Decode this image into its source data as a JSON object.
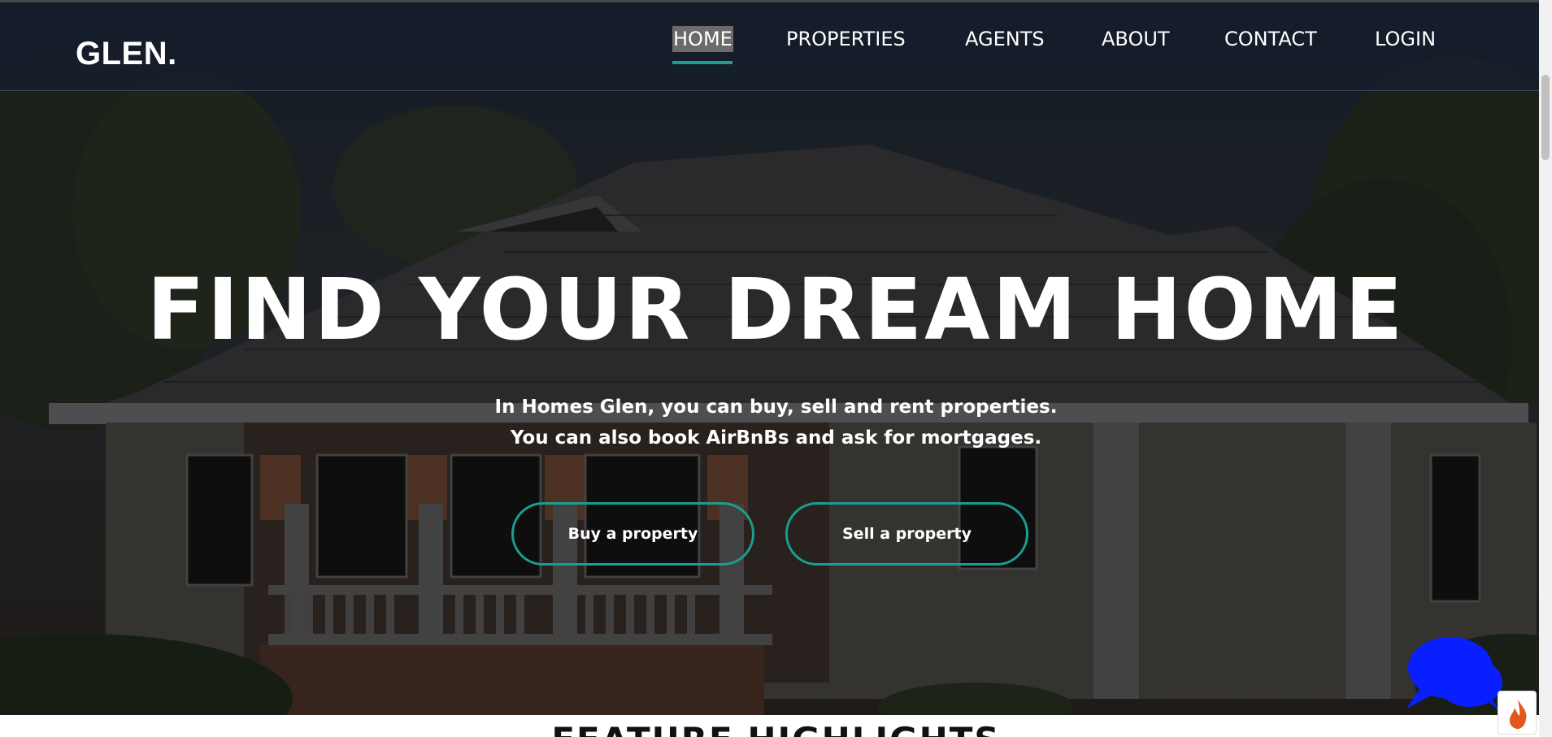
{
  "brand": "GLEN.",
  "nav": {
    "items": [
      {
        "label": "HOME",
        "active": true
      },
      {
        "label": "PROPERTIES"
      },
      {
        "label": "AGENTS"
      },
      {
        "label": "ABOUT"
      },
      {
        "label": "CONTACT"
      },
      {
        "label": "LOGIN"
      }
    ]
  },
  "hero": {
    "title": "FIND YOUR DREAM HOME",
    "subtitle_line1": "In Homes Glen, you can buy, sell and rent properties.",
    "subtitle_line2": "You can also book AirBnBs and ask for mortgages.",
    "buy_button": "Buy a property",
    "sell_button": "Sell a property"
  },
  "next_section": {
    "heading": "FEATURE HIGHLIGHTS"
  },
  "colors": {
    "accent": "#1a9e93",
    "navbar_bg": "#161e2c",
    "chat_bubble": "#0a1fff",
    "fire_icon": "#e2571e"
  },
  "icons": {
    "chat": "chat-bubbles-icon",
    "fire": "fire-icon"
  }
}
